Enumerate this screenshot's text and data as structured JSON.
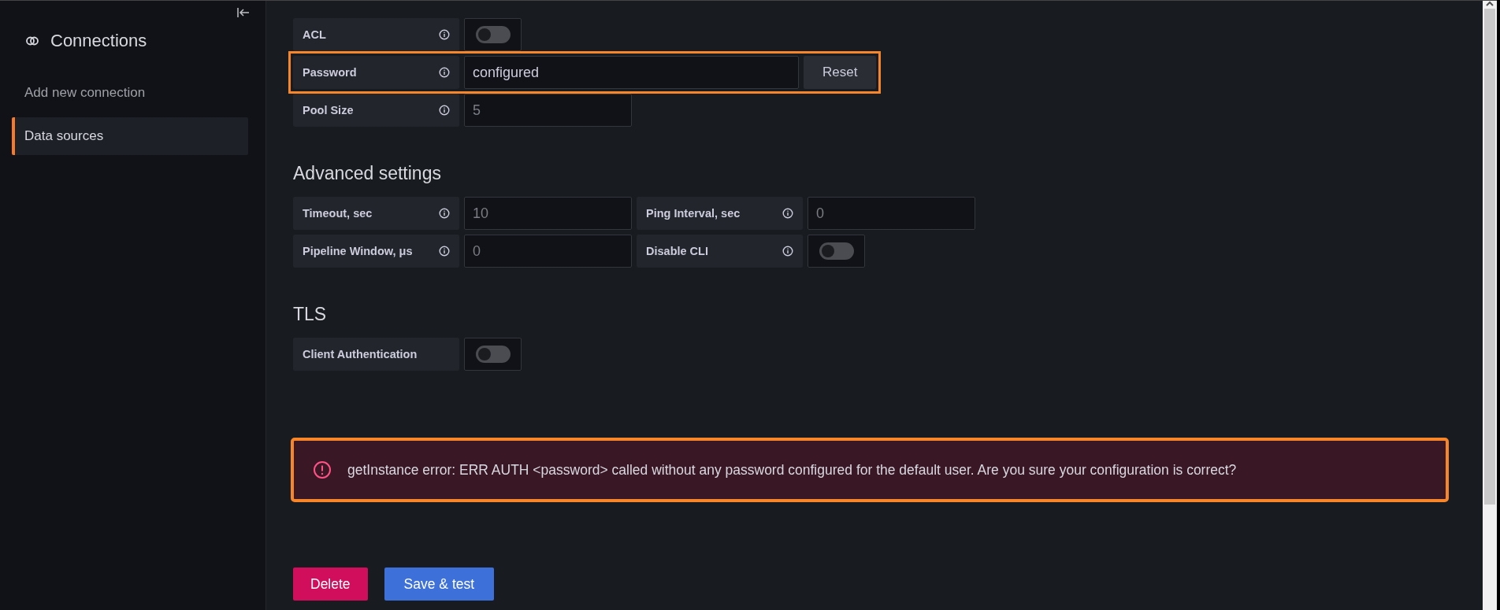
{
  "sidebar": {
    "title": "Connections",
    "items": [
      {
        "label": "Add new connection",
        "selected": false
      },
      {
        "label": "Data sources",
        "selected": true
      }
    ]
  },
  "sections": [
    {
      "rows": [
        [
          {
            "kind": "switch",
            "label": "ACL",
            "on": false
          }
        ],
        [
          {
            "kind": "secret",
            "label": "Password",
            "value": "configured",
            "button": "Reset",
            "highlighted": true
          }
        ],
        [
          {
            "kind": "input",
            "label": "Pool Size",
            "placeholder": "5"
          }
        ]
      ]
    },
    {
      "heading": "Advanced settings",
      "rows": [
        [
          {
            "kind": "input",
            "label": "Timeout, sec",
            "placeholder": "10"
          },
          {
            "kind": "input",
            "label": "Ping Interval, sec",
            "placeholder": "0"
          }
        ],
        [
          {
            "kind": "input",
            "label": "Pipeline Window, μs",
            "placeholder": "0"
          },
          {
            "kind": "switch",
            "label": "Disable CLI",
            "on": false
          }
        ]
      ]
    },
    {
      "heading": "TLS",
      "rows": [
        [
          {
            "kind": "switch",
            "label": "Client Authentication",
            "on": false,
            "info": false
          }
        ]
      ]
    }
  ],
  "alert": {
    "message": "getInstance error: ERR AUTH <password> called without any password configured for the default user. Are you sure your configuration is correct?",
    "highlighted": true
  },
  "buttons": [
    {
      "label": "Delete",
      "kind": "danger"
    },
    {
      "label": "Save & test",
      "kind": "primary"
    }
  ]
}
